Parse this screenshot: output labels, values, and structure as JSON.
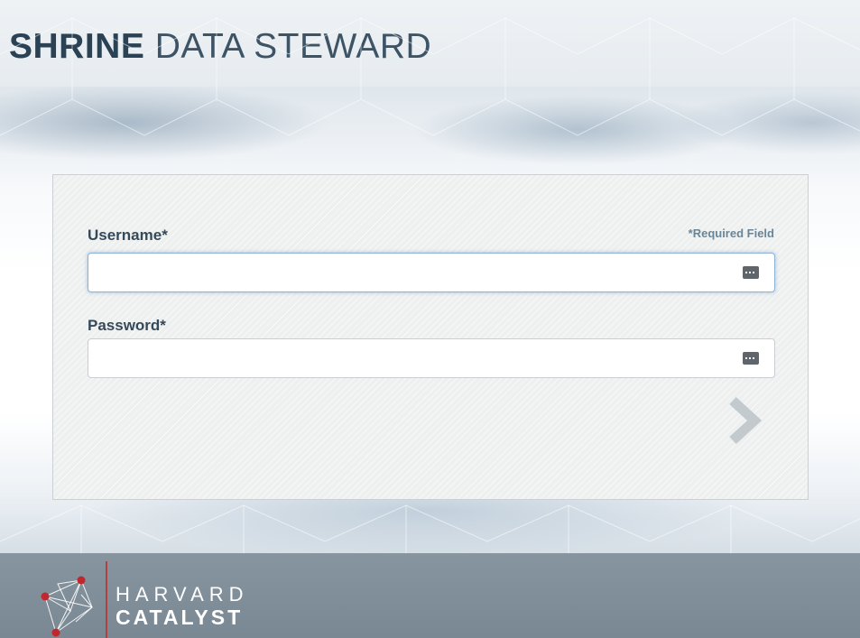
{
  "header": {
    "title_strong": "SHRINE",
    "title_light": "DATA STEWARD"
  },
  "login": {
    "username_label": "Username*",
    "password_label": "Password*",
    "required_note": "*Required Field",
    "username_value": "",
    "password_value": "",
    "username_focused": true,
    "key_icon": "password-manager-key-icon",
    "submit_icon": "chevron-right-icon"
  },
  "footer": {
    "logo_line1": "HARVARD",
    "logo_line2": "CATALYST",
    "logo_icon": "harvard-catalyst-logo-mark"
  },
  "colors": {
    "title": "#2b4254",
    "label": "#34495a",
    "required_note": "#6b8596",
    "footer_bg": "#7f8d98",
    "logo_accent": "#b0413e",
    "focus_ring": "#8fb3d8"
  }
}
